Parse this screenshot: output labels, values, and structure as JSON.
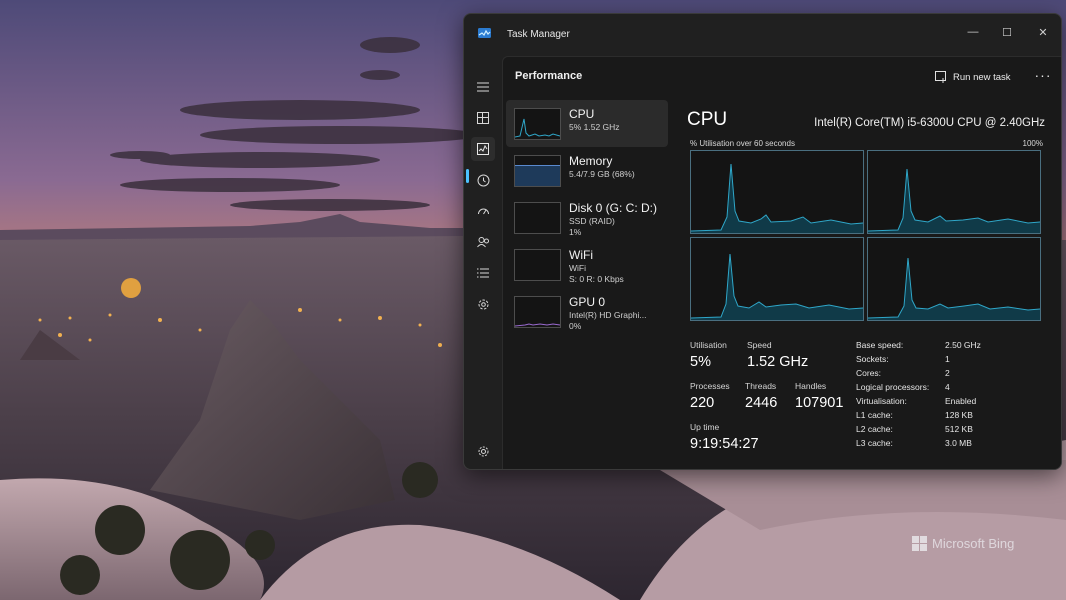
{
  "desktop": {
    "watermark": "Microsoft Bing"
  },
  "window": {
    "title": "Task Manager",
    "controls": {
      "minimize": "—",
      "maximize": "☐",
      "close": "✕"
    }
  },
  "nav": {
    "items": [
      "hamburger-icon",
      "processes-icon",
      "performance-icon",
      "app-history-icon",
      "startup-apps-icon",
      "users-icon",
      "details-icon",
      "services-icon"
    ],
    "active": "performance-icon",
    "settings": "settings-icon"
  },
  "header": {
    "page_title": "Performance",
    "run_new_task": "Run new task",
    "more": "···"
  },
  "resources": [
    {
      "name": "CPU",
      "line1": "5% 1.52 GHz",
      "line2": ""
    },
    {
      "name": "Memory",
      "line1": "5.4/7.9 GB (68%)",
      "line2": ""
    },
    {
      "name": "Disk 0 (G: C: D:)",
      "line1": "SSD (RAID)",
      "line2": "1%"
    },
    {
      "name": "WiFi",
      "line1": "WiFi",
      "line2": "S: 0 R: 0 Kbps"
    },
    {
      "name": "GPU 0",
      "line1": "Intel(R) HD Graphi...",
      "line2": "0%"
    }
  ],
  "detail": {
    "heading": "CPU",
    "model": "Intel(R) Core(TM) i5-6300U CPU @ 2.40GHz",
    "util_label": "% Utilisation over 60 seconds",
    "util_max": "100%",
    "stats": {
      "utilisation_label": "Utilisation",
      "utilisation": "5%",
      "speed_label": "Speed",
      "speed": "1.52 GHz",
      "processes_label": "Processes",
      "processes": "220",
      "threads_label": "Threads",
      "threads": "2446",
      "handles_label": "Handles",
      "handles": "107901",
      "uptime_label": "Up time",
      "uptime": "9:19:54:27"
    },
    "specs": [
      {
        "key": "Base speed:",
        "value": "2.50 GHz"
      },
      {
        "key": "Sockets:",
        "value": "1"
      },
      {
        "key": "Cores:",
        "value": "2"
      },
      {
        "key": "Logical processors:",
        "value": "4"
      },
      {
        "key": "Virtualisation:",
        "value": "Enabled"
      },
      {
        "key": "L1 cache:",
        "value": "128 KB"
      },
      {
        "key": "L2 cache:",
        "value": "512 KB"
      },
      {
        "key": "L3 cache:",
        "value": "3.0 MB"
      }
    ]
  },
  "colors": {
    "graph_line": "#2fa7c9",
    "graph_fill": "#103a48",
    "accent": "#4cc2ff",
    "memory_fill": "#1e3a5a"
  }
}
